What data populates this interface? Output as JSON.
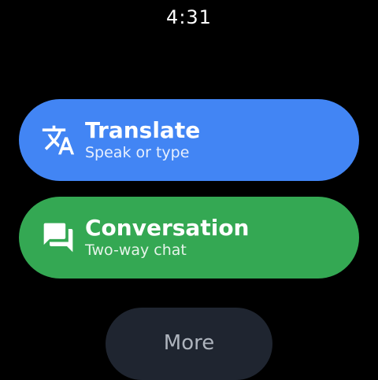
{
  "status_bar": {
    "time": "4:31"
  },
  "tiles": {
    "translate": {
      "title": "Translate",
      "subtitle": "Speak or type",
      "icon": "translate-icon",
      "color": "#4285f4"
    },
    "conversation": {
      "title": "Conversation",
      "subtitle": "Two-way chat",
      "icon": "chat-bubbles-icon",
      "color": "#34a853"
    }
  },
  "more_button": {
    "label": "More",
    "color": "#1f2530"
  }
}
